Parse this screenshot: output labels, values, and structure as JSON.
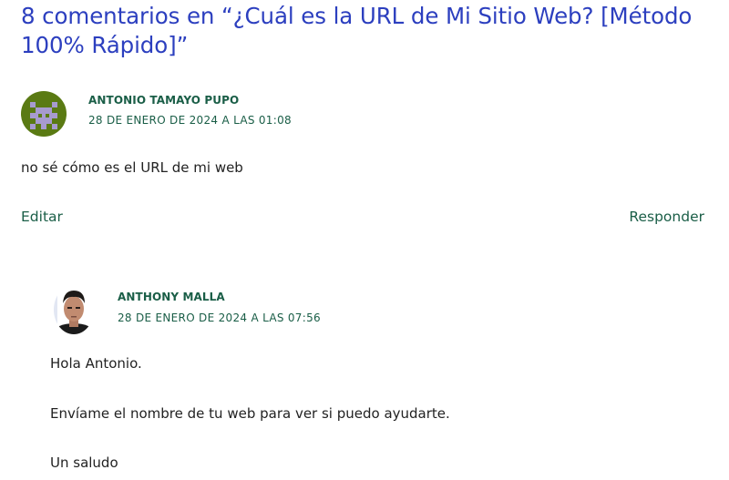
{
  "heading": "8 comentarios en “¿Cuál es la URL de Mi Sitio Web? [Método 100% Rápido]”",
  "comments": [
    {
      "author": "ANTONIO TAMAYO PUPO",
      "date": "28 DE ENERO DE 2024 A LAS 01:08",
      "text": "no sé cómo es el URL de mi web",
      "edit_label": "Editar",
      "reply_label": "Responder",
      "avatar": "pixel-identicon-icon"
    },
    {
      "author": "ANTHONY MALLA",
      "date": "28 DE ENERO DE 2024 A LAS 07:56",
      "paragraphs": [
        "Hola Antonio.",
        "Envíame el nombre de tu web para ver si puedo ayudarte.",
        "Un saludo"
      ],
      "avatar": "user-photo-avatar"
    }
  ],
  "colors": {
    "heading": "#2c3fbf",
    "author": "#1a5e47",
    "link": "#1a5e47"
  }
}
